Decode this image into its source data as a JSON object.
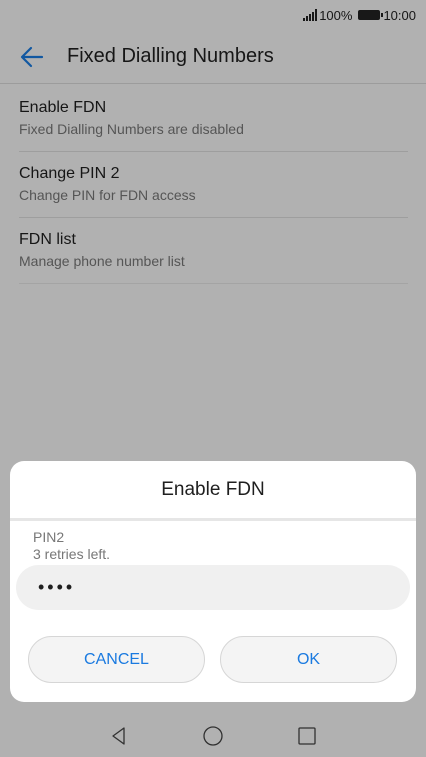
{
  "status_bar": {
    "battery": "100%",
    "time": "10:00"
  },
  "app_bar": {
    "title": "Fixed Dialling Numbers"
  },
  "settings": [
    {
      "title": "Enable FDN",
      "subtitle": "Fixed Dialling Numbers are disabled"
    },
    {
      "title": "Change PIN 2",
      "subtitle": "Change PIN for FDN access"
    },
    {
      "title": "FDN list",
      "subtitle": "Manage phone number list"
    }
  ],
  "dialog": {
    "title": "Enable FDN",
    "field_label": "PIN2",
    "retries_hint": "3 retries left.",
    "pin_value": "••••",
    "cancel_label": "CANCEL",
    "ok_label": "OK"
  },
  "colors": {
    "accent": "#1a7ae0",
    "background": "#f5f5f5"
  },
  "icons": {
    "back": "arrow-left-icon",
    "nav_back": "triangle-back-icon",
    "nav_home": "circle-home-icon",
    "nav_recent": "square-recent-icon"
  }
}
